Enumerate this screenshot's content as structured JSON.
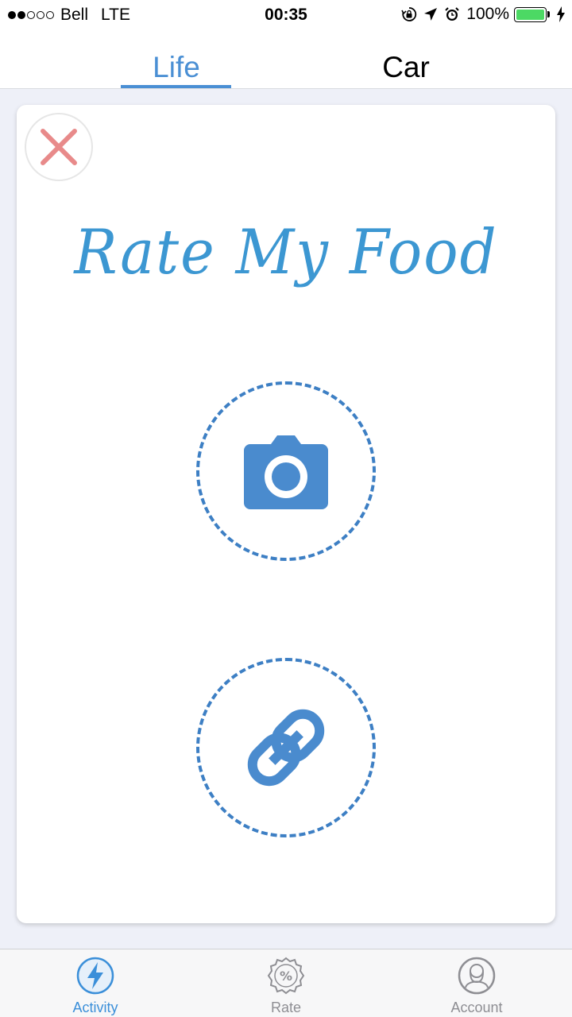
{
  "status_bar": {
    "carrier": "Bell",
    "network": "LTE",
    "time": "00:35",
    "battery_percent": "100%",
    "signal_bars_filled": 2,
    "signal_bars_total": 5
  },
  "top_tabs": [
    {
      "label": "Life",
      "active": true
    },
    {
      "label": "Car",
      "active": false
    }
  ],
  "card": {
    "title": "Rate My Food",
    "close_icon": "close-icon",
    "camera_icon": "camera-icon",
    "link_icon": "link-icon"
  },
  "bottom_tabs": [
    {
      "label": "Activity",
      "icon": "lightning-icon",
      "active": true
    },
    {
      "label": "Rate",
      "icon": "percent-badge-icon",
      "active": false
    },
    {
      "label": "Account",
      "icon": "user-icon",
      "active": false
    }
  ],
  "colors": {
    "accent": "#4a8fd4",
    "close": "#e88a8a",
    "background": "#eef0f8",
    "battery": "#4cd964"
  }
}
